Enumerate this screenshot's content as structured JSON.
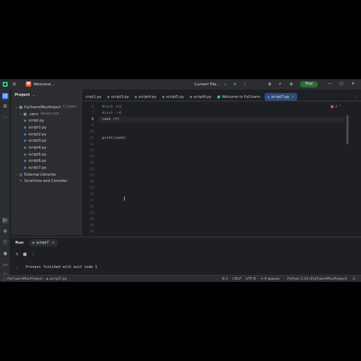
{
  "titlebar": {
    "project_initial": "W",
    "project_name": "Welcome",
    "run_config": "Current File",
    "trial_label": "Trial"
  },
  "project_panel": {
    "title": "Project",
    "root_name": "PyCharmMiscProject",
    "root_path": "C:\\Users",
    "items": [
      {
        "label": ".venv",
        "hint": "library root",
        "kind": "folder"
      },
      {
        "label": "script.py",
        "kind": "py"
      },
      {
        "label": "script1.py",
        "kind": "py"
      },
      {
        "label": "script2.py",
        "kind": "py"
      },
      {
        "label": "script3.py",
        "kind": "py"
      },
      {
        "label": "script4.py",
        "kind": "py"
      },
      {
        "label": "script5.py",
        "kind": "py"
      },
      {
        "label": "script6.py",
        "kind": "py"
      },
      {
        "label": "script7.py",
        "kind": "py"
      }
    ],
    "external_libraries": "External Libraries",
    "scratches": "Scratches and Consoles"
  },
  "tabs": [
    {
      "label": "cript1.py"
    },
    {
      "label": "script3.py"
    },
    {
      "label": "script4.py"
    },
    {
      "label": "script5.py"
    },
    {
      "label": "script6.py"
    },
    {
      "label": "Welcome to PyCharm"
    },
    {
      "label": "script7.py",
      "active": true
    }
  ],
  "error_count": "2",
  "editor": {
    "line_numbers": [
      "6",
      "7",
      "8",
      "9",
      "10",
      "11",
      "12",
      "13",
      "14",
      "15",
      "16",
      "17",
      "18",
      "19",
      "20",
      "21",
      "22",
      "23",
      "24",
      "25",
      "26"
    ],
    "lines": [
      "#cash +=2",
      "#cash -=8",
      "cash /=(",
      "",
      "",
      "print(cash)"
    ]
  },
  "run_panel": {
    "title": "Run",
    "tab_label": "script7",
    "output": "Process finished with exit code 1"
  },
  "statusbar": {
    "breadcrumb_project": "PyCharmMiscProject",
    "breadcrumb_file": "script7.py",
    "position": "8:3",
    "line_sep": "CRLF",
    "encoding": "UTF-8",
    "indent": "4 spaces",
    "interpreter": "Python 3.14 (PyCharmMiscProject)"
  }
}
